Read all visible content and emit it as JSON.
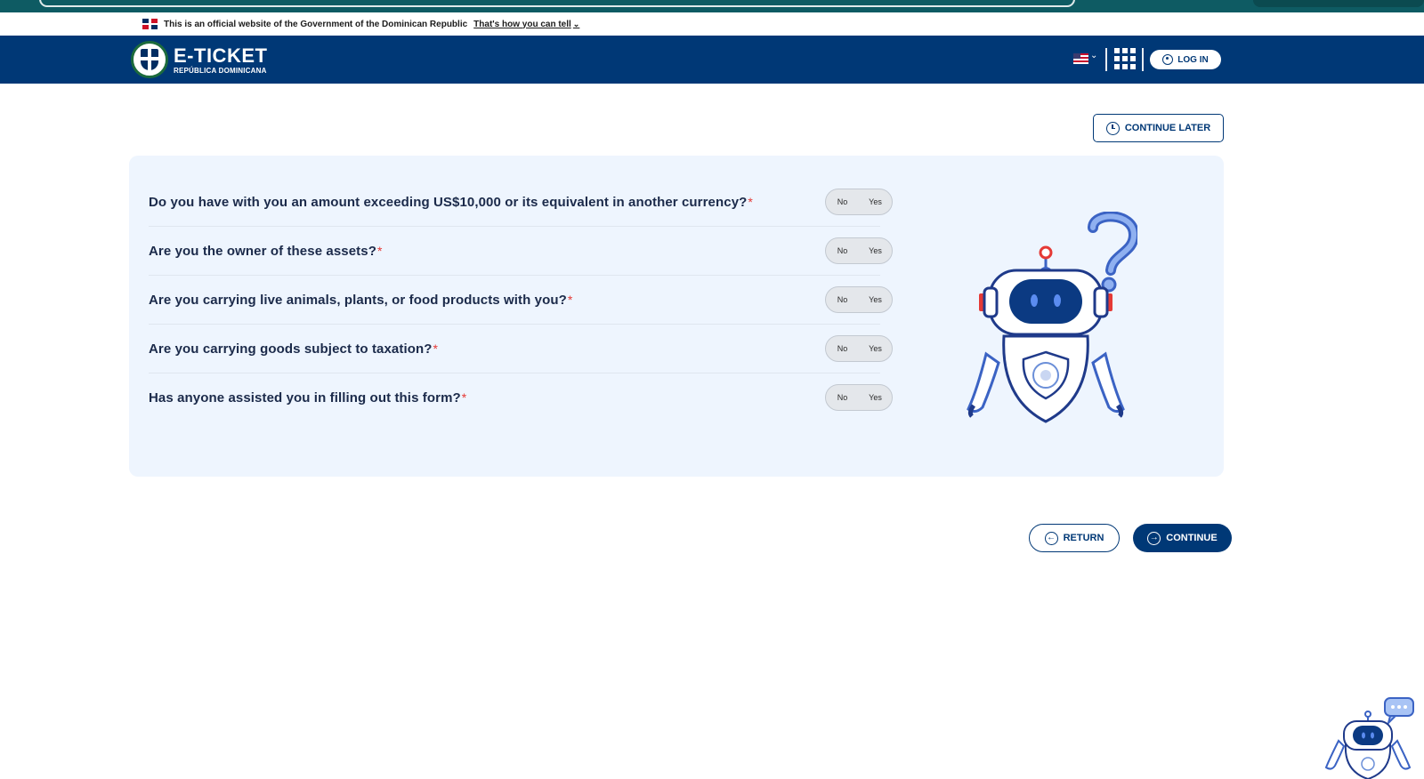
{
  "gov_banner": {
    "text": "This is an official website of the Government of the Dominican Republic",
    "link": "That's how you can tell"
  },
  "header": {
    "title": "E-TICKET",
    "subtitle": "REPÚBLICA DOMINICANA",
    "login_label": "LOG IN",
    "language_icon": "us-flag-icon",
    "apps_icon": "grid-apps-icon"
  },
  "actions": {
    "continue_later": "CONTINUE LATER",
    "return": "RETURN",
    "continue": "CONTINUE"
  },
  "questions": [
    {
      "text": "Do you have with you an amount exceeding US$10,000 or its equivalent in another currency?",
      "required": "*",
      "no": "No",
      "yes": "Yes"
    },
    {
      "text": "Are you the owner of these assets?",
      "required": "*",
      "no": "No",
      "yes": "Yes"
    },
    {
      "text": "Are you carrying live animals, plants, or food products with you?",
      "required": "*",
      "no": "No",
      "yes": "Yes"
    },
    {
      "text": "Are you carrying goods subject to taxation?",
      "required": "*",
      "no": "No",
      "yes": "Yes"
    },
    {
      "text": "Has anyone assisted you in filling out this form?",
      "required": "*",
      "no": "No",
      "yes": "Yes"
    }
  ],
  "colors": {
    "primary": "#003876",
    "panel_bg": "#eef5fe",
    "required": "#e53935",
    "browser_bar": "#0e5b63"
  }
}
